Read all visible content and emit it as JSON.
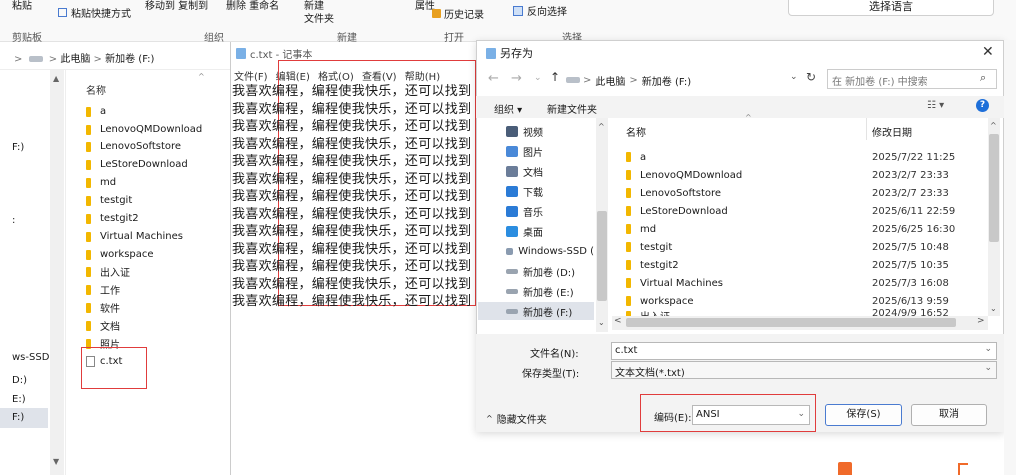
{
  "ribbon": {
    "paste": "粘贴",
    "paste_shortcut": "粘贴快捷方式",
    "move_copy": "移动到 复制到",
    "delete_rename": "删除 重命名",
    "new_folder": "新建\n文件夹",
    "new_folder_l1": "新建",
    "new_folder_l2": "文件夹",
    "properties": "属性",
    "history": "历史记录",
    "invert": "反向选择",
    "groups": {
      "clipboard": "剪贴板",
      "organize": "组织",
      "new": "新建",
      "open": "打开",
      "select": "选择"
    },
    "language_btn": "选择语言"
  },
  "explorer": {
    "breadcrumb": [
      ">",
      "此电脑",
      ">",
      "新加卷 (F:)"
    ],
    "col_name": "名称",
    "nav_left": [
      "F:)",
      "ws-SSD (",
      "D:)",
      "E:)",
      "F:)"
    ],
    "items": [
      {
        "name": "a",
        "type": "folder"
      },
      {
        "name": "LenovoQMDownload",
        "type": "folder"
      },
      {
        "name": "LenovoSoftstore",
        "type": "folder"
      },
      {
        "name": "LeStoreDownload",
        "type": "folder"
      },
      {
        "name": "md",
        "type": "folder"
      },
      {
        "name": "testgit",
        "type": "folder"
      },
      {
        "name": "testgit2",
        "type": "folder"
      },
      {
        "name": "Virtual Machines",
        "type": "folder"
      },
      {
        "name": "workspace",
        "type": "folder"
      },
      {
        "name": "出入证",
        "type": "folder"
      },
      {
        "name": "工作",
        "type": "folder"
      },
      {
        "name": "软件",
        "type": "folder"
      },
      {
        "name": "文档",
        "type": "folder"
      },
      {
        "name": "照片",
        "type": "folder"
      },
      {
        "name": "c.txt",
        "type": "txt"
      }
    ]
  },
  "notepad": {
    "title": "c.txt - 记事本",
    "menu": [
      "文件(F)",
      "编辑(E)",
      "格式(O)",
      "查看(V)",
      "帮助(H)"
    ],
    "line_text": "我喜欢编程，编程使我快乐，还可以找到",
    "line_count": 13
  },
  "dialog": {
    "title": "另存为",
    "close": "✕",
    "path": [
      ">",
      "此电脑",
      ">",
      "新加卷 (F:)"
    ],
    "search_placeholder": "在 新加卷 (F:) 中搜索",
    "organize": "组织 ▾",
    "new_folder": "新建文件夹",
    "nav": [
      {
        "name": "视频",
        "color": "#4a5d78"
      },
      {
        "name": "图片",
        "color": "#4a89d8"
      },
      {
        "name": "文档",
        "color": "#6b7d99"
      },
      {
        "name": "下载",
        "color": "#2b7bd6"
      },
      {
        "name": "音乐",
        "color": "#2b7bd6"
      },
      {
        "name": "桌面",
        "color": "#2b8de0"
      },
      {
        "name": "Windows-SSD (",
        "color": "#8a9bb0"
      },
      {
        "name": "新加卷 (D:)",
        "color": "#9aa4b0"
      },
      {
        "name": "新加卷 (E:)",
        "color": "#9aa4b0"
      },
      {
        "name": "新加卷 (F:)",
        "color": "#9aa4b0"
      }
    ],
    "col_name": "名称",
    "col_date": "修改日期",
    "items": [
      {
        "name": "a",
        "date": "2025/7/22 11:25"
      },
      {
        "name": "LenovoQMDownload",
        "date": "2023/2/7 23:33"
      },
      {
        "name": "LenovoSoftstore",
        "date": "2023/2/7 23:33"
      },
      {
        "name": "LeStoreDownload",
        "date": "2025/6/11 22:59"
      },
      {
        "name": "md",
        "date": "2025/6/25 16:30"
      },
      {
        "name": "testgit",
        "date": "2025/7/5 10:48"
      },
      {
        "name": "testgit2",
        "date": "2025/7/5 10:35"
      },
      {
        "name": "Virtual Machines",
        "date": "2025/7/3 16:08"
      },
      {
        "name": "workspace",
        "date": "2025/6/13 9:59"
      },
      {
        "name": "出入证",
        "date": "2024/9/9 16:52"
      }
    ],
    "filename_label": "文件名(N):",
    "filename_value": "c.txt",
    "filetype_label": "保存类型(T):",
    "filetype_value": "文本文档(*.txt)",
    "hide_folders": "隐藏文件夹",
    "encoding_label": "编码(E):",
    "encoding_value": "ANSI",
    "save": "保存(S)",
    "cancel": "取消"
  }
}
